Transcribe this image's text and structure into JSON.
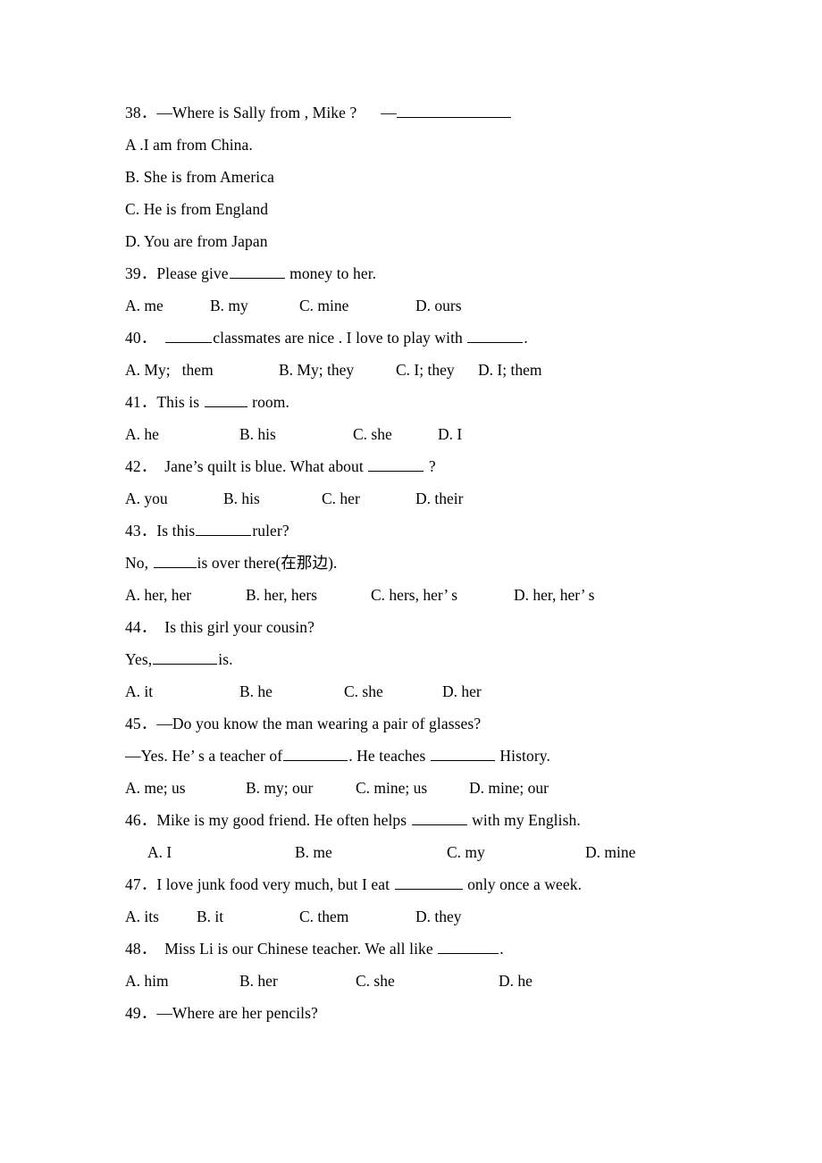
{
  "document": {
    "type": "english-grammar-multiple-choice-worksheet",
    "language_note": "在那边",
    "em_dash": "—",
    "full_width_period": "．",
    "apostrophe": "’"
  },
  "questions": [
    {
      "number": "38．",
      "stem_prefix": "—Where is Sally from , Mike ?",
      "stem_suffix": "—",
      "has_trailing_blank": true,
      "options_stacked": [
        "A .I am from China.",
        "B. She is from America",
        "C. He is from England",
        "D. You are from Japan"
      ]
    },
    {
      "number": "39．",
      "stem_before": "Please give",
      "stem_after": "money to her.",
      "options": [
        "A. me",
        "B. my",
        "C. mine",
        "D. ours"
      ],
      "option_x": [
        0,
        95,
        195,
        325
      ]
    },
    {
      "number": "40．",
      "stem_before": "",
      "stem_mid": "classmates are nice . I love to play with",
      "stem_after": ".",
      "options": [
        "A. My;   them",
        "B. My; they",
        "C. I; they",
        "D. I; them"
      ],
      "option_x": [
        0,
        172,
        303,
        395
      ]
    },
    {
      "number": "41．",
      "stem_before": "This is",
      "stem_after": "room.",
      "options": [
        "A. he",
        "B. his",
        "C. she",
        "D. I"
      ],
      "option_x": [
        0,
        128,
        255,
        350
      ]
    },
    {
      "number": "42．",
      "stem_before": "Jane’s quilt is blue. What about",
      "stem_after": "?",
      "options": [
        "A. you",
        "B. his",
        "C. her",
        "D. their"
      ],
      "option_x": [
        0,
        110,
        220,
        325
      ]
    },
    {
      "number": "43．",
      "stem_before": "Is this",
      "stem_after": "ruler?",
      "second_line_before": "No, ",
      "second_line_after": "is over there(在那边).",
      "options": [
        "A. her, her",
        "B. her, hers",
        "C. hers, her’ s",
        "D. her, her’ s"
      ],
      "option_x": [
        0,
        135,
        275,
        435
      ]
    },
    {
      "number": "44．",
      "stem_before": "Is this girl your cousin?",
      "second_line_before": "Yes,",
      "second_line_after": "is.",
      "options": [
        "A. it",
        "B. he",
        "C. she",
        "D. her"
      ],
      "option_x": [
        0,
        128,
        245,
        355
      ]
    },
    {
      "number": "45．",
      "stem_before": "—Do you know the man wearing a pair of glasses?",
      "second_line_a": "—Yes. He’ s a teacher of",
      "second_line_b": ". He teaches",
      "second_line_c": "History.",
      "options": [
        "A. me; us",
        "B. my; our",
        "C. mine; us",
        "D. mine; our"
      ],
      "option_x": [
        0,
        135,
        258,
        385
      ]
    },
    {
      "number": "46．",
      "stem_before": "Mike is my good friend. He often helps",
      "stem_after": "with my English.",
      "options": [
        "A. I",
        "B. me",
        "C. my",
        "D. mine"
      ],
      "option_x": [
        25,
        190,
        360,
        515
      ]
    },
    {
      "number": "47．",
      "stem_before": "I love junk food very much, but I eat",
      "stem_after": "only once a week.",
      "options": [
        "A. its",
        "B. it",
        "C. them",
        "D. they"
      ],
      "option_x": [
        0,
        80,
        195,
        325
      ]
    },
    {
      "number": "48．",
      "stem_before": "Miss Li is our Chinese teacher. We all like",
      "stem_after": ".",
      "options": [
        "A. him",
        "B. her",
        "C. she",
        "D. he"
      ],
      "option_x": [
        0,
        128,
        258,
        418
      ]
    },
    {
      "number": "49．",
      "stem_before": "—Where are her pencils?"
    }
  ]
}
